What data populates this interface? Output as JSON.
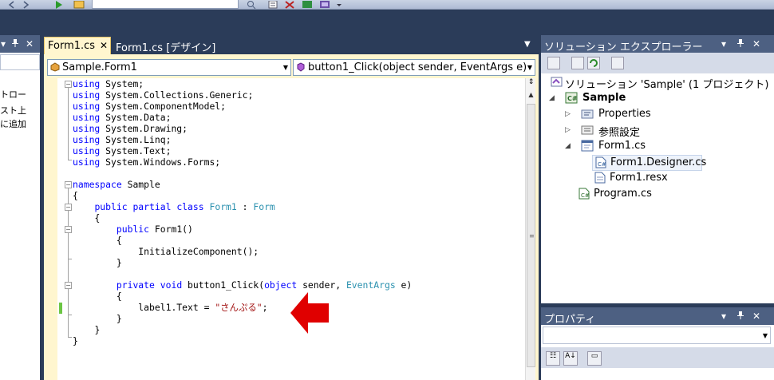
{
  "left_panel": {
    "pin_label": "ᵖ",
    "close_label": "✕",
    "lines": [
      "トロー",
      "スト上",
      "に追加"
    ]
  },
  "editor": {
    "tabs": [
      {
        "label": "Form1.cs",
        "active": true
      },
      {
        "label": "Form1.cs [デザイン]",
        "active": false
      }
    ],
    "close_label": "✕",
    "dropdown_label": "▼",
    "class_combo": "Sample.Form1",
    "member_combo": "button1_Click(object sender, EventArgs e)",
    "code": [
      "using System;",
      "using System.Collections.Generic;",
      "using System.ComponentModel;",
      "using System.Data;",
      "using System.Drawing;",
      "using System.Linq;",
      "using System.Text;",
      "using System.Windows.Forms;",
      "",
      "namespace Sample",
      "{",
      "public partial class Form1 : Form",
      "{",
      "public Form1()",
      "{",
      "InitializeComponent();",
      "}",
      "",
      "private void button1_Click(object sender, EventArgs e)",
      "{",
      "label1.Text = \"さんぷる\";",
      "}",
      "}",
      "}"
    ],
    "code_tokens": {
      "using": "using",
      "namespace": "namespace",
      "public": "public",
      "partial": "partial",
      "class": "class",
      "private": "private",
      "void": "void",
      "object": "object",
      "Form1_class": "Form1",
      "Form": "Form",
      "EventArgs": "EventArgs",
      "string_literal": "\"さんぷる\""
    }
  },
  "solution_explorer": {
    "title": "ソリューション エクスプローラー",
    "controls": [
      "▾",
      "ᵖ",
      "✕"
    ],
    "tree": [
      {
        "label": "ソリューション 'Sample' (1 プロジェクト)",
        "icon": "solution-icon",
        "expander": ""
      },
      {
        "label": "Sample",
        "icon": "csharp-project-icon",
        "expander": "◢",
        "bold": true
      },
      {
        "label": "Properties",
        "icon": "properties-icon",
        "expander": "▷"
      },
      {
        "label": "参照設定",
        "icon": "references-icon",
        "expander": "▷"
      },
      {
        "label": "Form1.cs",
        "icon": "form-icon",
        "expander": "◢"
      },
      {
        "label": "Form1.Designer.cs",
        "icon": "csharp-file-icon",
        "expander": "",
        "selected": true
      },
      {
        "label": "Form1.resx",
        "icon": "resx-icon",
        "expander": ""
      },
      {
        "label": "Program.cs",
        "icon": "csharp-file-icon",
        "expander": ""
      }
    ]
  },
  "properties": {
    "title": "プロパティ",
    "controls": [
      "▾",
      "ᵖ",
      "✕"
    ]
  },
  "colors": {
    "keyword": "#0000ff",
    "type": "#2b91af",
    "string": "#a31515",
    "panel_header": "#4d6082",
    "arrow": "#e00000"
  }
}
